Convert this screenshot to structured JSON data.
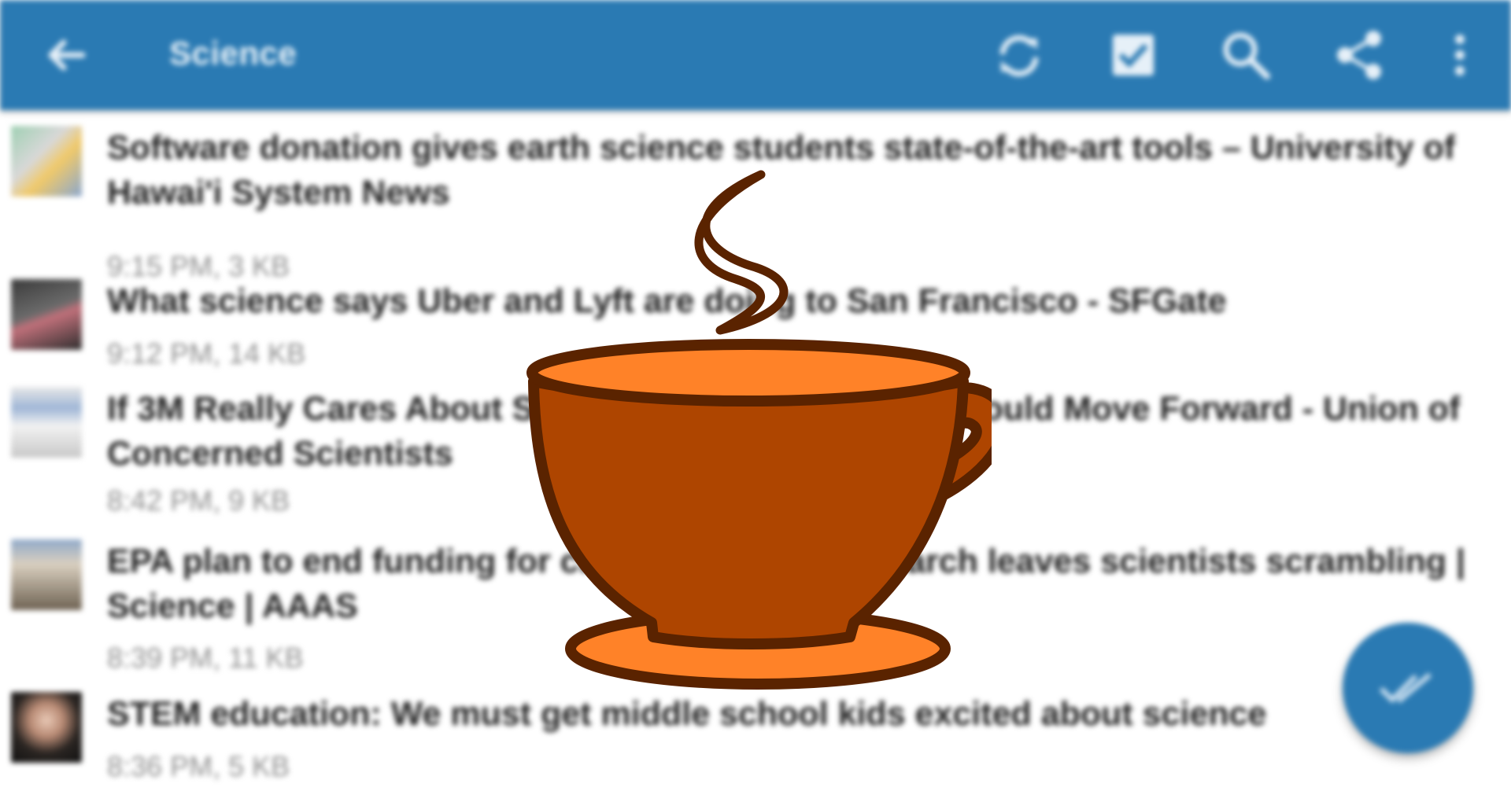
{
  "toolbar": {
    "title": "Science",
    "icons": [
      "back-arrow-icon",
      "refresh-icon",
      "checkbox-icon",
      "search-icon",
      "share-icon",
      "overflow-menu-icon"
    ],
    "color": "#2a7ab3"
  },
  "articles": [
    {
      "title": "Software donation gives earth science students state-of-the-art tools – University of Hawai'i System News",
      "meta": "9:15 PM, 3 KB"
    },
    {
      "title": "What science says Uber and Lyft are doing to San Francisco - SFGate",
      "meta": "9:12 PM, 14 KB"
    },
    {
      "title": "If 3M Really Cares About Science, Here's How They Should Move Forward - Union of Concerned Scientists",
      "meta": "8:42 PM, 9 KB"
    },
    {
      "title": "EPA plan to end funding for children's health research leaves scientists scrambling | Science | AAAS",
      "meta": "8:39 PM, 11 KB"
    },
    {
      "title": "STEM education: We must get middle school kids excited about science",
      "meta": "8:36 PM, 5 KB"
    }
  ],
  "fab": {
    "icon": "double-check-icon"
  },
  "overlay": {
    "icon": "coffee-cup-icon",
    "colors": {
      "outline": "#5a2300",
      "cup": "#ae4500",
      "fill_light": "#ff8228"
    }
  }
}
